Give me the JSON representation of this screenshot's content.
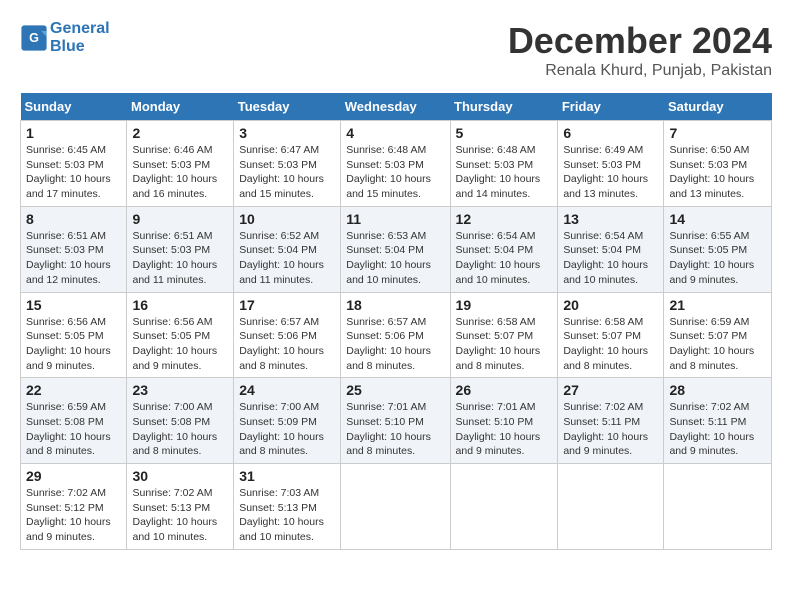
{
  "app": {
    "logo_line1": "General",
    "logo_line2": "Blue"
  },
  "header": {
    "month": "December 2024",
    "location": "Renala Khurd, Punjab, Pakistan"
  },
  "days_of_week": [
    "Sunday",
    "Monday",
    "Tuesday",
    "Wednesday",
    "Thursday",
    "Friday",
    "Saturday"
  ],
  "weeks": [
    [
      {
        "day": "1",
        "info": "Sunrise: 6:45 AM\nSunset: 5:03 PM\nDaylight: 10 hours\nand 17 minutes."
      },
      {
        "day": "2",
        "info": "Sunrise: 6:46 AM\nSunset: 5:03 PM\nDaylight: 10 hours\nand 16 minutes."
      },
      {
        "day": "3",
        "info": "Sunrise: 6:47 AM\nSunset: 5:03 PM\nDaylight: 10 hours\nand 15 minutes."
      },
      {
        "day": "4",
        "info": "Sunrise: 6:48 AM\nSunset: 5:03 PM\nDaylight: 10 hours\nand 15 minutes."
      },
      {
        "day": "5",
        "info": "Sunrise: 6:48 AM\nSunset: 5:03 PM\nDaylight: 10 hours\nand 14 minutes."
      },
      {
        "day": "6",
        "info": "Sunrise: 6:49 AM\nSunset: 5:03 PM\nDaylight: 10 hours\nand 13 minutes."
      },
      {
        "day": "7",
        "info": "Sunrise: 6:50 AM\nSunset: 5:03 PM\nDaylight: 10 hours\nand 13 minutes."
      }
    ],
    [
      {
        "day": "8",
        "info": "Sunrise: 6:51 AM\nSunset: 5:03 PM\nDaylight: 10 hours\nand 12 minutes."
      },
      {
        "day": "9",
        "info": "Sunrise: 6:51 AM\nSunset: 5:03 PM\nDaylight: 10 hours\nand 11 minutes."
      },
      {
        "day": "10",
        "info": "Sunrise: 6:52 AM\nSunset: 5:04 PM\nDaylight: 10 hours\nand 11 minutes."
      },
      {
        "day": "11",
        "info": "Sunrise: 6:53 AM\nSunset: 5:04 PM\nDaylight: 10 hours\nand 10 minutes."
      },
      {
        "day": "12",
        "info": "Sunrise: 6:54 AM\nSunset: 5:04 PM\nDaylight: 10 hours\nand 10 minutes."
      },
      {
        "day": "13",
        "info": "Sunrise: 6:54 AM\nSunset: 5:04 PM\nDaylight: 10 hours\nand 10 minutes."
      },
      {
        "day": "14",
        "info": "Sunrise: 6:55 AM\nSunset: 5:05 PM\nDaylight: 10 hours\nand 9 minutes."
      }
    ],
    [
      {
        "day": "15",
        "info": "Sunrise: 6:56 AM\nSunset: 5:05 PM\nDaylight: 10 hours\nand 9 minutes."
      },
      {
        "day": "16",
        "info": "Sunrise: 6:56 AM\nSunset: 5:05 PM\nDaylight: 10 hours\nand 9 minutes."
      },
      {
        "day": "17",
        "info": "Sunrise: 6:57 AM\nSunset: 5:06 PM\nDaylight: 10 hours\nand 8 minutes."
      },
      {
        "day": "18",
        "info": "Sunrise: 6:57 AM\nSunset: 5:06 PM\nDaylight: 10 hours\nand 8 minutes."
      },
      {
        "day": "19",
        "info": "Sunrise: 6:58 AM\nSunset: 5:07 PM\nDaylight: 10 hours\nand 8 minutes."
      },
      {
        "day": "20",
        "info": "Sunrise: 6:58 AM\nSunset: 5:07 PM\nDaylight: 10 hours\nand 8 minutes."
      },
      {
        "day": "21",
        "info": "Sunrise: 6:59 AM\nSunset: 5:07 PM\nDaylight: 10 hours\nand 8 minutes."
      }
    ],
    [
      {
        "day": "22",
        "info": "Sunrise: 6:59 AM\nSunset: 5:08 PM\nDaylight: 10 hours\nand 8 minutes."
      },
      {
        "day": "23",
        "info": "Sunrise: 7:00 AM\nSunset: 5:08 PM\nDaylight: 10 hours\nand 8 minutes."
      },
      {
        "day": "24",
        "info": "Sunrise: 7:00 AM\nSunset: 5:09 PM\nDaylight: 10 hours\nand 8 minutes."
      },
      {
        "day": "25",
        "info": "Sunrise: 7:01 AM\nSunset: 5:10 PM\nDaylight: 10 hours\nand 8 minutes."
      },
      {
        "day": "26",
        "info": "Sunrise: 7:01 AM\nSunset: 5:10 PM\nDaylight: 10 hours\nand 9 minutes."
      },
      {
        "day": "27",
        "info": "Sunrise: 7:02 AM\nSunset: 5:11 PM\nDaylight: 10 hours\nand 9 minutes."
      },
      {
        "day": "28",
        "info": "Sunrise: 7:02 AM\nSunset: 5:11 PM\nDaylight: 10 hours\nand 9 minutes."
      }
    ],
    [
      {
        "day": "29",
        "info": "Sunrise: 7:02 AM\nSunset: 5:12 PM\nDaylight: 10 hours\nand 9 minutes."
      },
      {
        "day": "30",
        "info": "Sunrise: 7:02 AM\nSunset: 5:13 PM\nDaylight: 10 hours\nand 10 minutes."
      },
      {
        "day": "31",
        "info": "Sunrise: 7:03 AM\nSunset: 5:13 PM\nDaylight: 10 hours\nand 10 minutes."
      },
      null,
      null,
      null,
      null
    ]
  ]
}
